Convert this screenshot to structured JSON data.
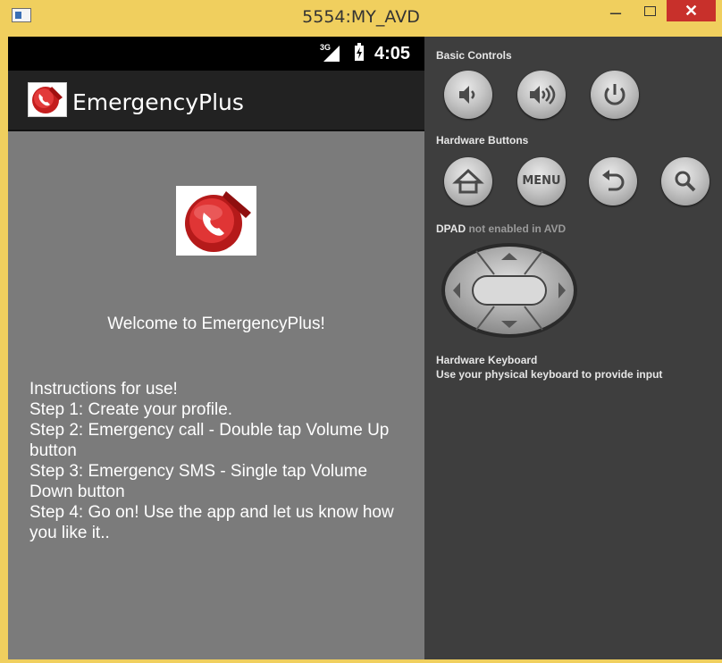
{
  "window": {
    "title": "5554:MY_AVD",
    "minimize": "–",
    "close": "✕"
  },
  "statusbar": {
    "network": "3G",
    "time": "4:05"
  },
  "app": {
    "name": "EmergencyPlus",
    "welcome": "Welcome to EmergencyPlus!",
    "instructions": [
      "Instructions for use!",
      "Step 1: Create your profile.",
      "Step 2: Emergency call - Double tap Volume Up button",
      "Step 3: Emergency SMS - Single tap Volume Down button",
      "Step 4: Go on! Use the app and let us know how you like it.."
    ]
  },
  "controls": {
    "basic_title": "Basic Controls",
    "basic_buttons": [
      "volume-down-icon",
      "volume-up-icon",
      "power-icon"
    ],
    "hardware_title": "Hardware Buttons",
    "hardware_buttons": [
      "home-icon",
      "MENU",
      "back-icon",
      "search-icon"
    ],
    "menu_label": "MENU",
    "dpad_title": "DPAD",
    "dpad_note": "not enabled in AVD",
    "keyboard_title": "Hardware Keyboard",
    "keyboard_note": "Use your physical keyboard to provide input"
  },
  "colors": {
    "window_frame": "#f0cf5e",
    "close_button": "#c8302b",
    "app_background": "#7b7b7b",
    "actionbar": "#222222",
    "controls_panel": "#3e3e3e"
  }
}
